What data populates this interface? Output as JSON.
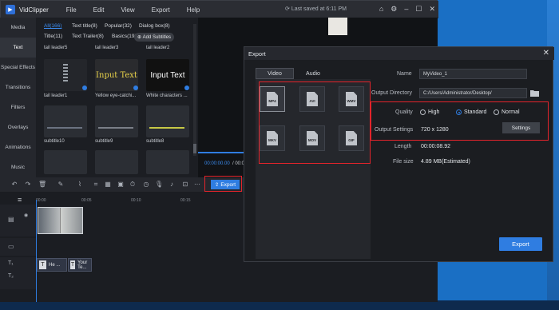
{
  "app": {
    "name": "VidClipper",
    "menu": [
      "File",
      "Edit",
      "View",
      "Export",
      "Help"
    ],
    "saved_status": "Last saved at 6:11 PM"
  },
  "sidebar": {
    "items": [
      {
        "label": "Media"
      },
      {
        "label": "Text"
      },
      {
        "label": "Special Effects"
      },
      {
        "label": "Transitions"
      },
      {
        "label": "Filters"
      },
      {
        "label": "Overlays"
      },
      {
        "label": "Animations"
      },
      {
        "label": "Music"
      }
    ]
  },
  "library": {
    "tabs": [
      "All(166)",
      "Text title(8)",
      "Popular(32)",
      "Dialog box(8)",
      "Title(11)",
      "Text Trailer(8)",
      "Basics(19)"
    ],
    "add_subtitles": "Add Subtitles",
    "items": [
      {
        "label": "tail leader5",
        "preview": ""
      },
      {
        "label": "tail leader3",
        "preview": ""
      },
      {
        "label": "tail leader2",
        "preview": ""
      },
      {
        "label": "tail leader1",
        "preview": ""
      },
      {
        "label": "Yellow eye-catchi...",
        "preview": "Input Text"
      },
      {
        "label": "White characters ...",
        "preview": "Input Text"
      },
      {
        "label": "subtitle10",
        "preview": ""
      },
      {
        "label": "subtitle9",
        "preview": ""
      },
      {
        "label": "subtitle8",
        "preview": ""
      }
    ]
  },
  "preview": {
    "current": "00:00:00.00",
    "total": "00:00"
  },
  "toolbar": {
    "export_label": "Export"
  },
  "timeline": {
    "ruler": [
      "00:00",
      "00:05",
      "00:10",
      "00:15"
    ],
    "text_clips": [
      "He ...",
      "Your Te..."
    ]
  },
  "dialog": {
    "title": "Export",
    "tabs": [
      "Video",
      "Audio"
    ],
    "formats": [
      "MP4",
      "AVI",
      "WMV",
      "MKV",
      "MOV",
      "GIF"
    ],
    "selected_format": "MP4",
    "fields": {
      "name_label": "Name",
      "name_value": "MyVideo_1",
      "dir_label": "Output Directory",
      "dir_value": "C:/Users/Administrator/Desktop/",
      "quality_label": "Quality",
      "quality_options": [
        "High",
        "Standard",
        "Normal"
      ],
      "quality_selected": "Standard",
      "settings_label": "Output Settings",
      "settings_value": "720 x 1280",
      "settings_button": "Settings",
      "length_label": "Length",
      "length_value": "00:00:08.92",
      "filesize_label": "File size",
      "filesize_value": "4.89 MB(Estimated)"
    },
    "export_button": "Export"
  },
  "colors": {
    "accent": "#2f7de1",
    "highlight_box": "#e3242b",
    "window_bg": "#1f2126"
  }
}
